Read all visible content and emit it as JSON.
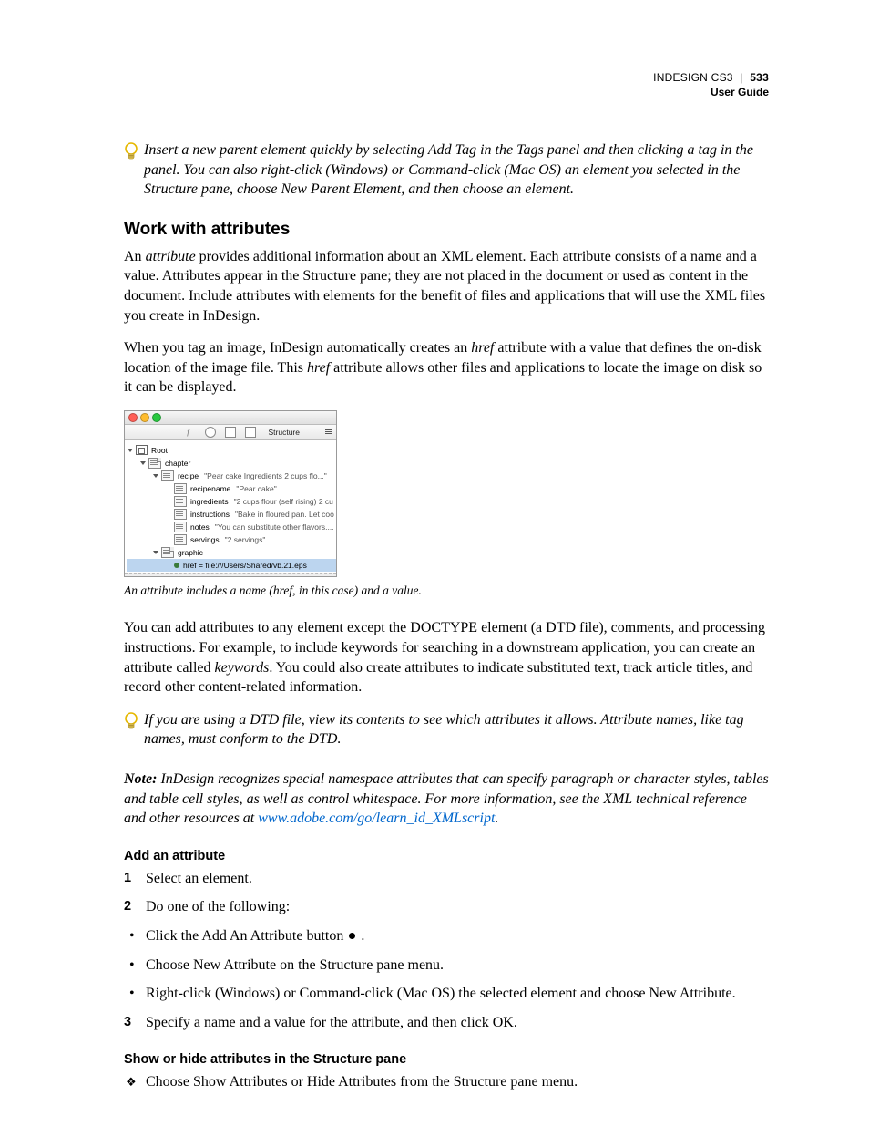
{
  "header": {
    "product": "INDESIGN CS3",
    "page_number": "533",
    "doc_title": "User Guide"
  },
  "tip1": "Insert a new parent element quickly by selecting Add Tag in the Tags panel and then clicking a tag in the panel. You can also right-click (Windows) or Command-click (Mac OS) an element you selected in the Structure pane, choose New Parent Element, and then choose an element.",
  "section_title": "Work with attributes",
  "p1a": "An ",
  "p1b": "attribute",
  "p1c": " provides additional information about an XML element. Each attribute consists of a name and a value. Attributes appear in the Structure pane; they are not placed in the document or used as content in the document. Include attributes with elements for the benefit of files and applications that will use the XML files you create in InDesign.",
  "p2a": "When you tag an image, InDesign automatically creates an ",
  "p2b": "href",
  "p2c": " attribute with a value that defines the on-disk location of the image file. This ",
  "p2d": "href",
  "p2e": " attribute allows other files and applications to locate the image on disk so it can be displayed.",
  "figure": {
    "panel_label": "Structure",
    "tree": {
      "root": "Root",
      "chapter": "chapter",
      "recipe": "recipe",
      "recipe_val": "\"Pear cake Ingredients 2 cups flo...\"",
      "recipename": "recipename",
      "recipename_val": "\"Pear cake\"",
      "ingredients": "ingredients",
      "ingredients_val": "\"2 cups flour (self rising) 2 cu",
      "instructions": "instructions",
      "instructions_val": "\"Bake in floured pan. Let coo",
      "notes": "notes",
      "notes_val": "\"You can substitute other flavors....",
      "servings": "servings",
      "servings_val": "\"2 servings\"",
      "graphic": "graphic",
      "attr": "href = file:///Users/Shared/vb.21.eps"
    }
  },
  "caption": "An attribute includes a name (href, in this case) and a value.",
  "p3a": "You can add attributes to any element except the DOCTYPE element (a DTD file), comments, and processing instructions. For example, to include keywords for searching in a downstream application, you can create an attribute called ",
  "p3b": "keywords",
  "p3c": ". You could also create attributes to indicate substituted text, track article titles, and record other content-related information.",
  "tip2": "If you are using a DTD file, view its contents to see which attributes it allows. Attribute names, like tag names, must conform to the DTD.",
  "note_label": "Note:",
  "note_body": " InDesign recognizes special namespace attributes that can specify paragraph or character styles, tables and table cell styles, as well as control whitespace. For more information, see the XML technical reference and other resources at ",
  "note_link": "www.adobe.com/go/learn_id_XMLscript",
  "note_end": ".",
  "h3a": "Add an attribute",
  "steps": {
    "s1": "Select an element.",
    "s2": "Do one of the following:",
    "s3": "Specify a name and a value for the attribute, and then click OK."
  },
  "bullets": {
    "b1a": "Click the Add An Attribute button ",
    "b1b": " .",
    "b2": "Choose New Attribute on the Structure pane menu.",
    "b3": "Right-click (Windows) or Command-click (Mac OS) the selected element and choose New Attribute."
  },
  "h3b": "Show or hide attributes in the Structure pane",
  "show_hide": "Choose Show Attributes or Hide Attributes from the Structure pane menu."
}
